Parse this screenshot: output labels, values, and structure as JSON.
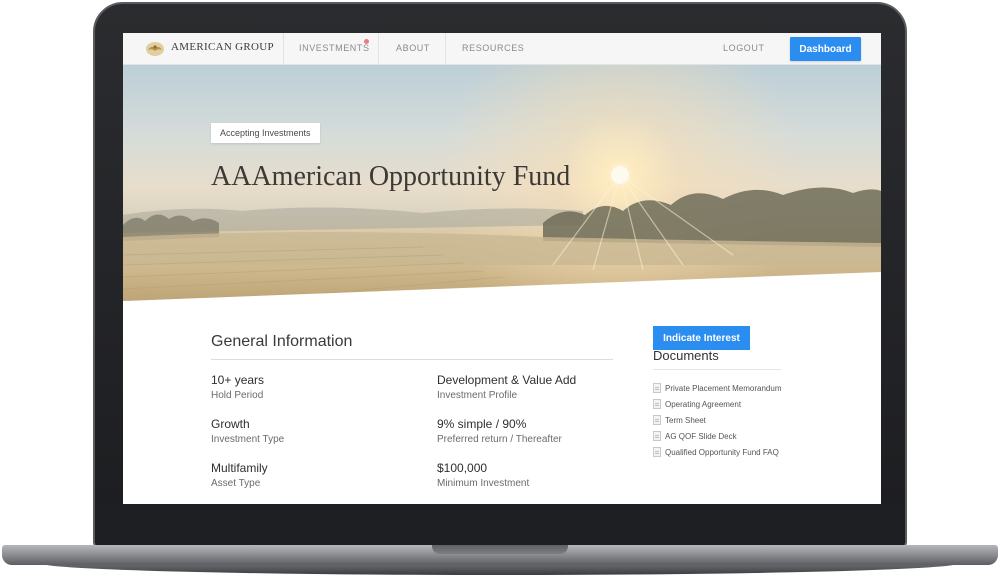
{
  "nav": {
    "logo_text": "AMERICAN GROUP",
    "links": [
      "INVESTMENTS",
      "ABOUT",
      "RESOURCES"
    ],
    "logout": "LOGOUT",
    "dashboard": "Dashboard"
  },
  "hero": {
    "badge": "Accepting Investments",
    "title": "AAAmerican Opportunity Fund"
  },
  "general": {
    "title": "General Information",
    "items": [
      {
        "value": "10+ years",
        "label": "Hold Period"
      },
      {
        "value": "Development & Value Add",
        "label": "Investment Profile"
      },
      {
        "value": "Growth",
        "label": "Investment Type"
      },
      {
        "value": "9% simple / 90%",
        "label": "Preferred return / Thereafter"
      },
      {
        "value": "Multifamily",
        "label": "Asset Type"
      },
      {
        "value": "$100,000",
        "label": "Minimum Investment"
      }
    ]
  },
  "sidebar": {
    "interest_button": "Indicate Interest",
    "documents_title": "Documents",
    "documents": [
      "Private Placement Memorandum",
      "Operating Agreement",
      "Term Sheet",
      "AG QOF Slide Deck",
      "Qualified Opportunity Fund FAQ"
    ]
  },
  "colors": {
    "accent": "#2b8df0",
    "notification": "#f07b7b"
  }
}
